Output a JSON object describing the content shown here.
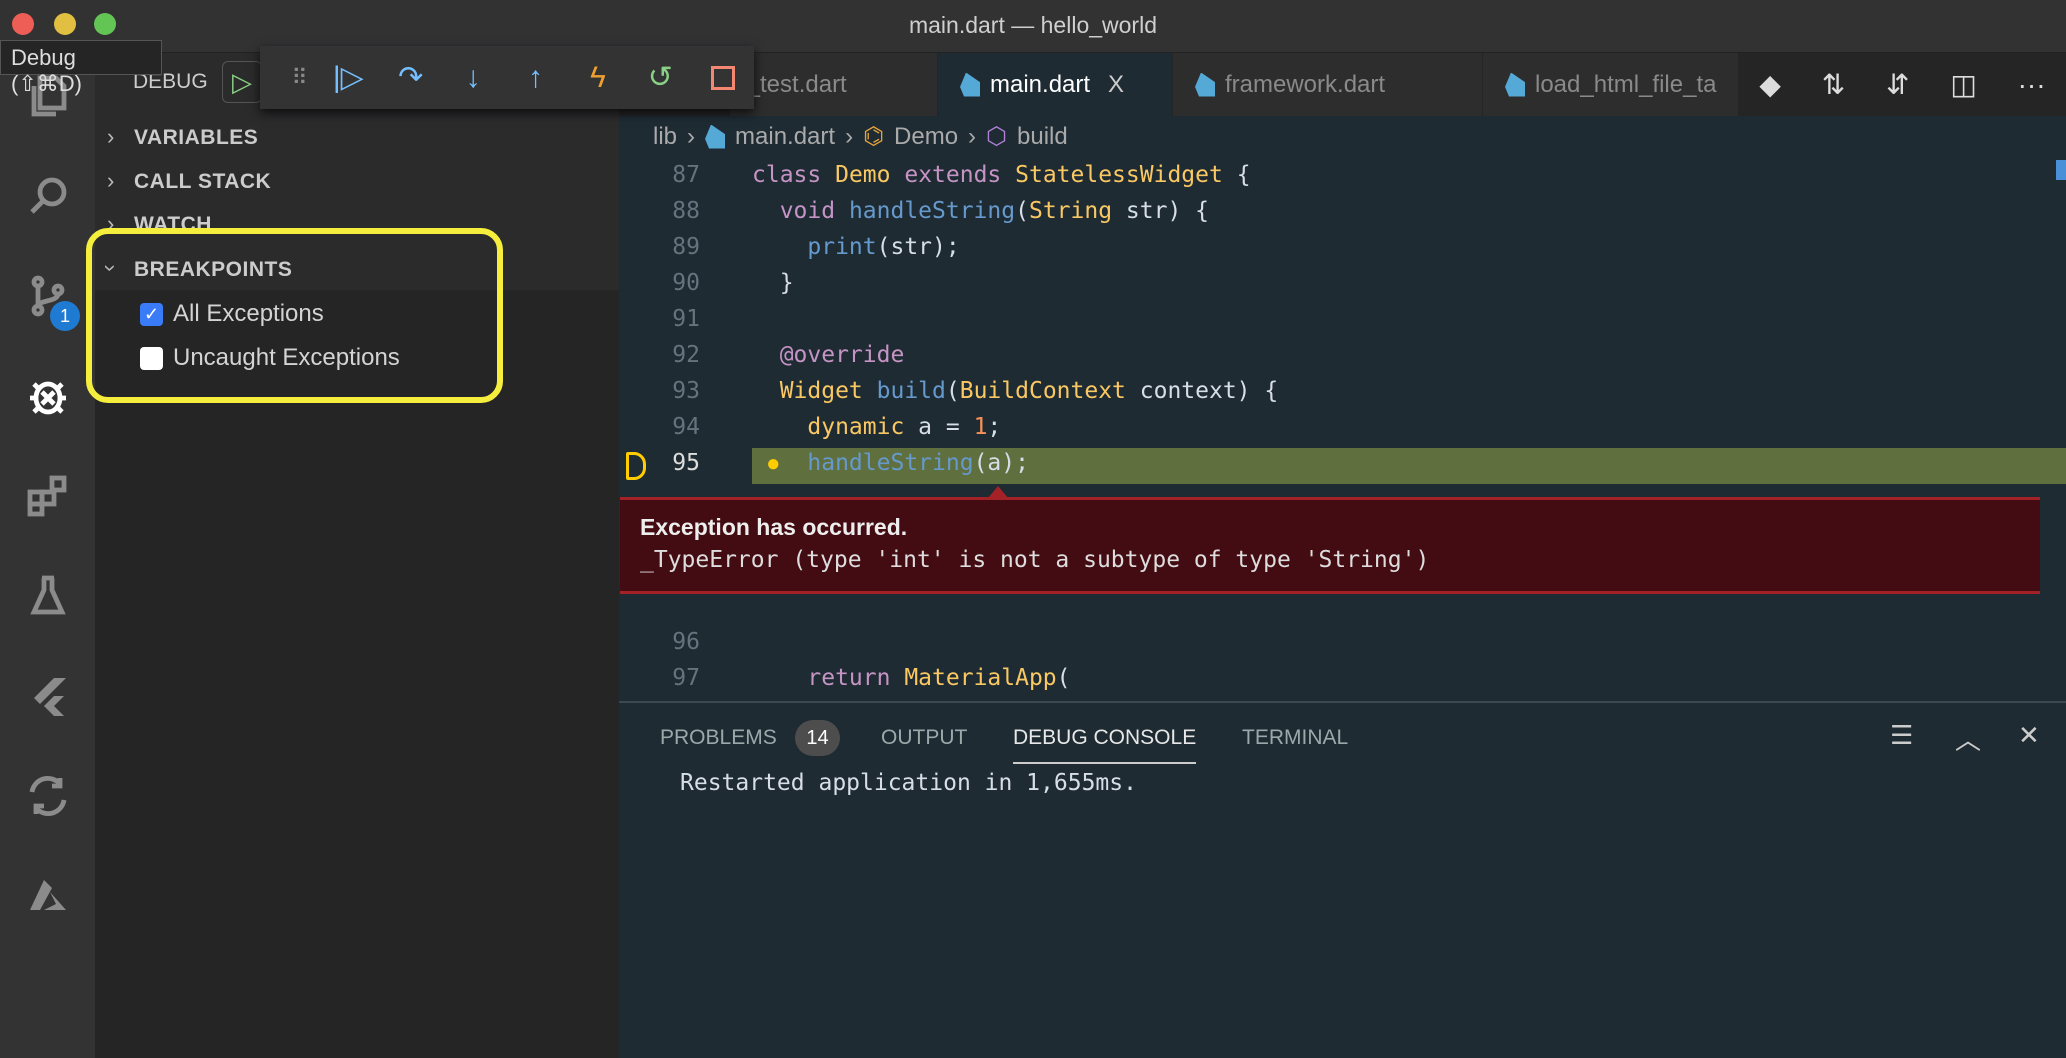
{
  "window": {
    "title": "main.dart — hello_world",
    "colors": {
      "close": "#ee5e56",
      "minimize": "#e1bf41",
      "maximize": "#62c554"
    }
  },
  "tooltip": "Debug (⇧⌘D)",
  "activity_bar": [
    "explorer-icon",
    "search-icon",
    "source-control-icon",
    "debug-icon",
    "extensions-icon",
    "testing-icon",
    "flutter-icon",
    "diff-icon",
    "azure-icon"
  ],
  "scm_badge": "1",
  "sidebar": {
    "title": "DEBUG",
    "sections": [
      "VARIABLES",
      "CALL STACK",
      "WATCH",
      "BREAKPOINTS"
    ],
    "breakpoints": [
      {
        "label": "All Exceptions",
        "checked": true
      },
      {
        "label": "Uncaught Exceptions",
        "checked": false
      }
    ]
  },
  "debug_toolbar": [
    "drag-handle",
    "continue",
    "step-over",
    "step-into",
    "step-out",
    "hot-reload",
    "restart",
    "stop"
  ],
  "tabs": [
    {
      "label": "t_test.dart"
    },
    {
      "label": "main.dart",
      "active": true,
      "close": "X"
    },
    {
      "label": "framework.dart"
    },
    {
      "label": "load_html_file_ta"
    }
  ],
  "breadcrumb": [
    "lib",
    "main.dart",
    "Demo",
    "build"
  ],
  "code": [
    {
      "n": "87",
      "t": [
        [
          "class ",
          "kw"
        ],
        [
          "Demo ",
          "ty"
        ],
        [
          "extends ",
          "kw"
        ],
        [
          "StatelessWidget ",
          "ty"
        ],
        [
          "{",
          "pn"
        ]
      ]
    },
    {
      "n": "88",
      "t": [
        [
          "  void ",
          "kw"
        ],
        [
          "handleString",
          "fn"
        ],
        [
          "(",
          "pn"
        ],
        [
          "String ",
          "ty"
        ],
        [
          "str) {",
          "pl"
        ]
      ]
    },
    {
      "n": "89",
      "t": [
        [
          "    print",
          "fn"
        ],
        [
          "(str);",
          "pl"
        ]
      ]
    },
    {
      "n": "90",
      "t": [
        [
          "  }",
          "pl"
        ]
      ]
    },
    {
      "n": "91",
      "t": []
    },
    {
      "n": "92",
      "t": [
        [
          "  @override",
          "an"
        ]
      ]
    },
    {
      "n": "93",
      "t": [
        [
          "  Widget ",
          "ty"
        ],
        [
          "build",
          "fn"
        ],
        [
          "(",
          "pn"
        ],
        [
          "BuildContext ",
          "ty"
        ],
        [
          "context) {",
          "pl"
        ]
      ]
    },
    {
      "n": "94",
      "t": [
        [
          "    dynamic ",
          "ty"
        ],
        [
          "a = ",
          "pl"
        ],
        [
          "1",
          "nm"
        ],
        [
          ";",
          "pl"
        ]
      ]
    },
    {
      "n": "95",
      "t": [
        [
          "    handleString",
          "fn"
        ],
        [
          "(a);",
          "pl"
        ]
      ]
    }
  ],
  "code_after": [
    {
      "n": "96",
      "t": []
    },
    {
      "n": "97",
      "t": [
        [
          "    return ",
          "kw"
        ],
        [
          "MaterialApp",
          "ty"
        ],
        [
          "(",
          "pl"
        ]
      ]
    }
  ],
  "exception": {
    "title": "Exception has occurred.",
    "message": "_TypeError (type 'int' is not a subtype of type 'String')"
  },
  "panel": {
    "tabs": [
      "PROBLEMS",
      "OUTPUT",
      "DEBUG CONSOLE",
      "TERMINAL"
    ],
    "problems_count": "14",
    "active": "DEBUG CONSOLE",
    "output": "Restarted application in 1,655ms."
  }
}
